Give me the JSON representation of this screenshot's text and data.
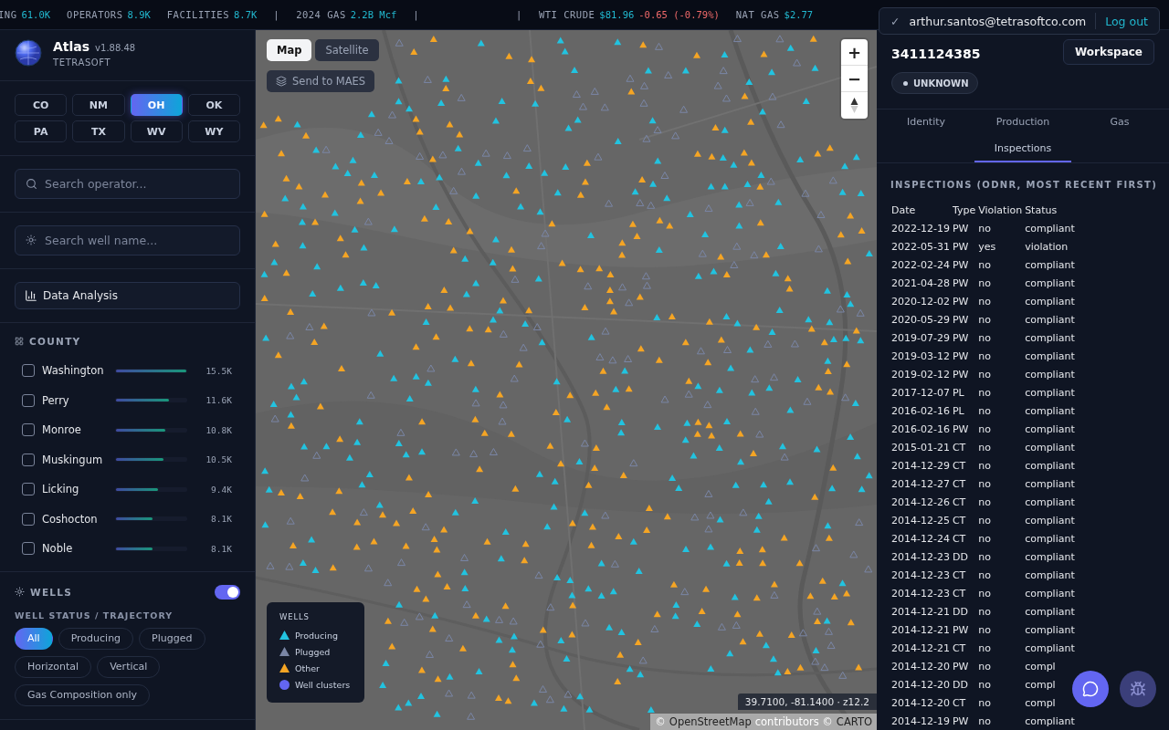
{
  "ticker": [
    {
      "kind": "stat",
      "label": "ING",
      "value": "61.0K"
    },
    {
      "kind": "stat",
      "label": "OPERATORS",
      "value": "8.9K"
    },
    {
      "kind": "stat",
      "label": "FACILITIES",
      "value": "8.7K"
    },
    {
      "kind": "divider",
      "label": "|"
    },
    {
      "kind": "stat",
      "label": "2024 GAS",
      "value": "2.2B Mcf"
    },
    {
      "kind": "divider",
      "label": "|"
    },
    {
      "kind": "gap"
    },
    {
      "kind": "divider",
      "label": "|"
    },
    {
      "kind": "quote",
      "label": "WTI CRUDE",
      "value": "$81.96",
      "change": "-0.65 (-0.79%)"
    },
    {
      "kind": "quote",
      "label": "NAT GAS",
      "value": "$2.77"
    }
  ],
  "user_menu": {
    "check": "✓",
    "email": "arthur.santos@tetrasoftco.com",
    "logout": "Log out"
  },
  "brand": {
    "name": "Atlas",
    "version": "v1.88.48",
    "company": "TETRASOFT"
  },
  "states": [
    {
      "label": "CO",
      "selected": false
    },
    {
      "label": "NM",
      "selected": false
    },
    {
      "label": "OH",
      "selected": true
    },
    {
      "label": "OK",
      "selected": false
    },
    {
      "label": "PA",
      "selected": false
    },
    {
      "label": "TX",
      "selected": false
    },
    {
      "label": "WV",
      "selected": false
    },
    {
      "label": "WY",
      "selected": false
    }
  ],
  "operator_search": {
    "placeholder": "Search operator..."
  },
  "well_search": {
    "placeholder": "Search well name..."
  },
  "data_analysis": "Data Analysis",
  "county": {
    "title": "COUNTY",
    "items": [
      {
        "name": "Washington",
        "count": "15.5K",
        "level": 1,
        "checked": false
      },
      {
        "name": "Perry",
        "count": "11.6K",
        "level": 0.75,
        "checked": false
      },
      {
        "name": "Monroe",
        "count": "10.8K",
        "level": 0.7,
        "checked": false
      },
      {
        "name": "Muskingum",
        "count": "10.5K",
        "level": 0.68,
        "checked": false
      },
      {
        "name": "Licking",
        "count": "9.4K",
        "level": 0.6,
        "checked": false
      },
      {
        "name": "Coshocton",
        "count": "8.1K",
        "level": 0.52,
        "checked": false
      },
      {
        "name": "Noble",
        "count": "8.1K",
        "level": 0.52,
        "checked": false
      }
    ]
  },
  "wells": {
    "title": "WELLS",
    "on": true,
    "subtitle": "WELL STATUS / TRAJECTORY",
    "filters": [
      {
        "label": "All",
        "selected": true
      },
      {
        "label": "Producing",
        "selected": false
      },
      {
        "label": "Plugged",
        "selected": false
      },
      {
        "label": "Horizontal",
        "selected": false
      },
      {
        "label": "Vertical",
        "selected": false
      },
      {
        "label": "Gas Composition only",
        "selected": false
      }
    ]
  },
  "map": {
    "layers": [
      {
        "label": "Map",
        "selected": true
      },
      {
        "label": "Satellite",
        "selected": false
      }
    ],
    "send": "Send to MAES",
    "zoom_in": "+",
    "zoom_out": "−",
    "legend": {
      "title": "WELLS",
      "items": [
        {
          "kind": "triangle",
          "label": "Producing",
          "color": "#22c3e0"
        },
        {
          "kind": "triangle",
          "label": "Plugged",
          "color": "#7a86a6"
        },
        {
          "kind": "triangle",
          "label": "Other",
          "color": "#f5a524"
        },
        {
          "kind": "dot",
          "label": "Well clusters",
          "color": "#6366f1"
        }
      ]
    },
    "coords": "39.7100, -81.1400 · z12.2",
    "attribution": {
      "prefix": "©",
      "link1": "OpenStreetMap",
      "middle": "contributors ©",
      "link2": "CARTO"
    }
  },
  "well": {
    "id": "3411124385",
    "workspace": "Workspace",
    "status": "UNKNOWN",
    "tabs": [
      {
        "label": "Identity",
        "selected": false
      },
      {
        "label": "Production",
        "selected": false
      },
      {
        "label": "Gas",
        "selected": false
      },
      {
        "label": "Inspections",
        "selected": true
      }
    ],
    "section": "INSPECTIONS (ODNR, MOST RECENT FIRST)",
    "columns": [
      "Date",
      "Type",
      "Violation",
      "Status"
    ],
    "rows": [
      [
        "2022-12-19",
        "PW",
        "no",
        "compliant"
      ],
      [
        "2022-05-31",
        "PW",
        "yes",
        "violation"
      ],
      [
        "2022-02-24",
        "PW",
        "no",
        "compliant"
      ],
      [
        "2021-04-28",
        "PW",
        "no",
        "compliant"
      ],
      [
        "2020-12-02",
        "PW",
        "no",
        "compliant"
      ],
      [
        "2020-05-29",
        "PW",
        "no",
        "compliant"
      ],
      [
        "2019-07-29",
        "PW",
        "no",
        "compliant"
      ],
      [
        "2019-03-12",
        "PW",
        "no",
        "compliant"
      ],
      [
        "2019-02-12",
        "PW",
        "no",
        "compliant"
      ],
      [
        "2017-12-07",
        "PL",
        "no",
        "compliant"
      ],
      [
        "2016-02-16",
        "PL",
        "no",
        "compliant"
      ],
      [
        "2016-02-16",
        "PW",
        "no",
        "compliant"
      ],
      [
        "2015-01-21",
        "CT",
        "no",
        "compliant"
      ],
      [
        "2014-12-29",
        "CT",
        "no",
        "compliant"
      ],
      [
        "2014-12-27",
        "CT",
        "no",
        "compliant"
      ],
      [
        "2014-12-26",
        "CT",
        "no",
        "compliant"
      ],
      [
        "2014-12-25",
        "CT",
        "no",
        "compliant"
      ],
      [
        "2014-12-24",
        "CT",
        "no",
        "compliant"
      ],
      [
        "2014-12-23",
        "DD",
        "no",
        "compliant"
      ],
      [
        "2014-12-23",
        "CT",
        "no",
        "compliant"
      ],
      [
        "2014-12-23",
        "CT",
        "no",
        "compliant"
      ],
      [
        "2014-12-21",
        "DD",
        "no",
        "compliant"
      ],
      [
        "2014-12-21",
        "PW",
        "no",
        "compliant"
      ],
      [
        "2014-12-21",
        "CT",
        "no",
        "compliant"
      ],
      [
        "2014-12-20",
        "PW",
        "no",
        "compl"
      ],
      [
        "2014-12-20",
        "DD",
        "no",
        "compl"
      ],
      [
        "2014-12-20",
        "CT",
        "no",
        "compl"
      ],
      [
        "2014-12-19",
        "PW",
        "no",
        "compliant"
      ]
    ]
  }
}
